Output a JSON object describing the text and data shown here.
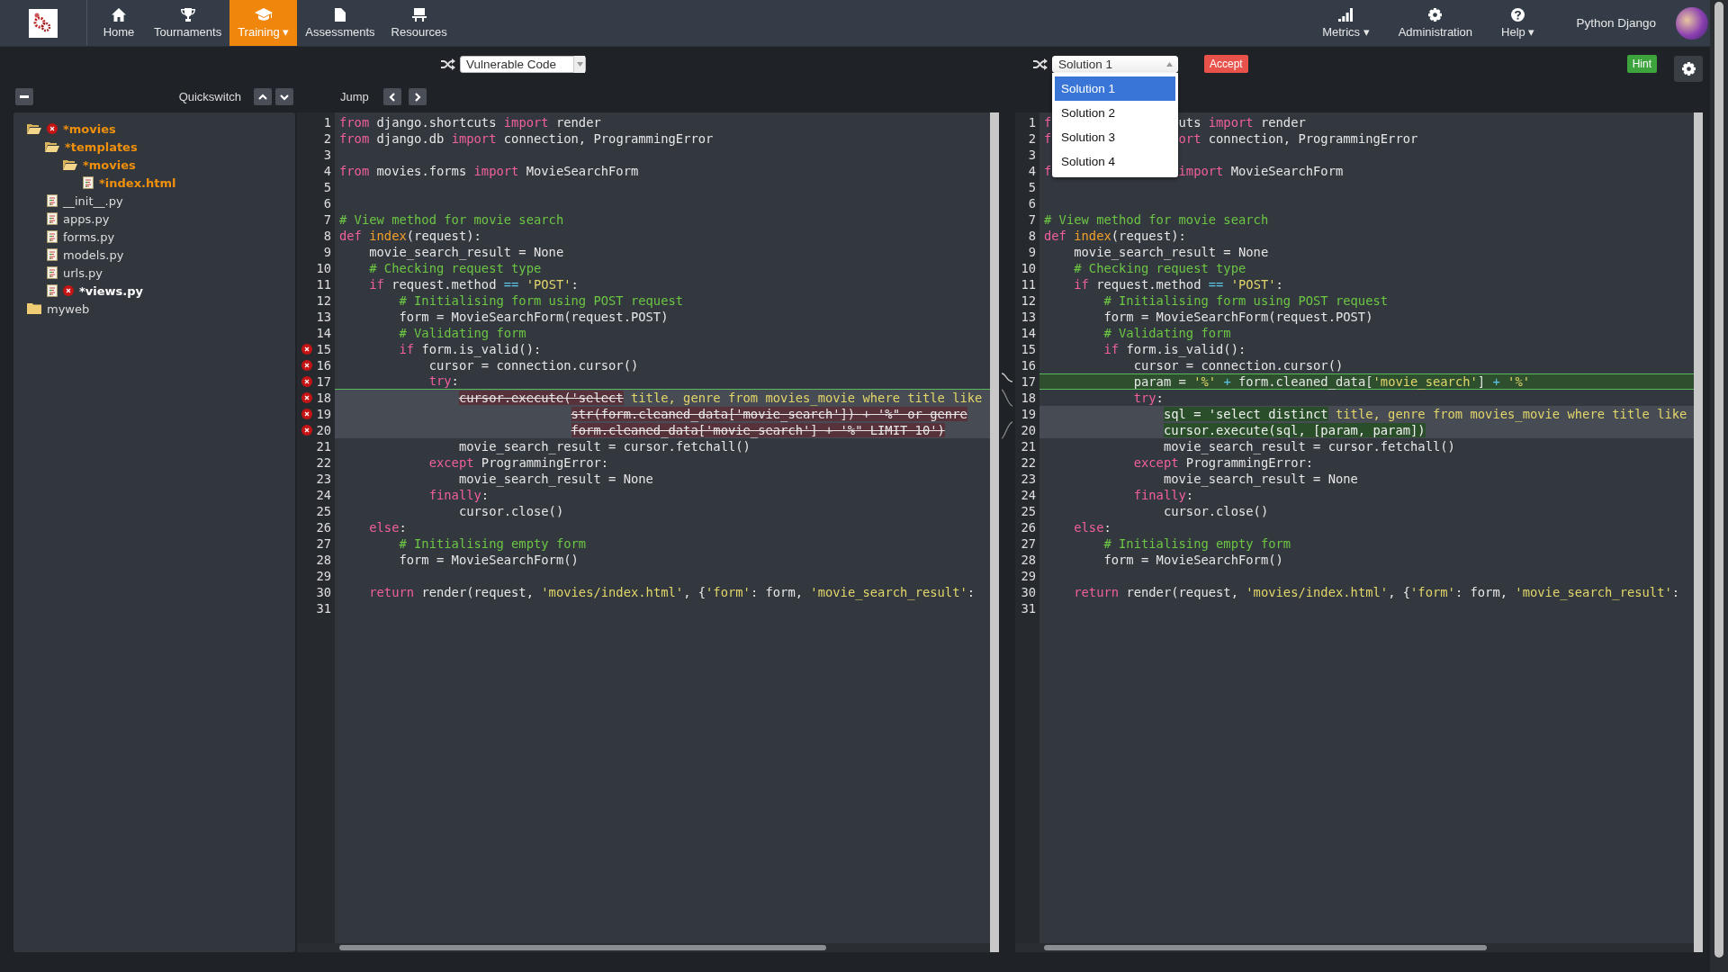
{
  "nav": {
    "items": [
      {
        "label": "Home",
        "selected": false
      },
      {
        "label": "Tournaments",
        "selected": false
      },
      {
        "label": "Training ▾",
        "selected": true
      },
      {
        "label": "Assessments",
        "selected": false
      },
      {
        "label": "Resources",
        "selected": false
      }
    ],
    "right_items": [
      {
        "label": "Metrics ▾"
      },
      {
        "label": "Administration"
      },
      {
        "label": "Help ▾"
      }
    ],
    "user": "Python Django"
  },
  "toolbar": {
    "quickswitch": "Quickswitch",
    "jump": "Jump",
    "left_select": "Vulnerable Code",
    "right_select": {
      "value": "Solution 1",
      "expanded": true,
      "options": [
        {
          "label": "Solution 1",
          "selected": true
        },
        {
          "label": "Solution 2",
          "selected": false
        },
        {
          "label": "Solution 3",
          "selected": false
        },
        {
          "label": "Solution 4",
          "selected": false
        }
      ]
    },
    "accept": "Accept",
    "hint": "Hint"
  },
  "tree": [
    {
      "label": "*movies",
      "kind": "folder",
      "expanded": true,
      "modified": true,
      "error": true,
      "selected": false,
      "children": [
        {
          "label": "*templates",
          "kind": "folder",
          "expanded": true,
          "modified": true,
          "error": false,
          "selected": false,
          "children": [
            {
              "label": "*movies",
              "kind": "folder",
              "expanded": true,
              "modified": true,
              "error": false,
              "selected": false,
              "children": [
                {
                  "label": "*index.html",
                  "kind": "file",
                  "modified": true,
                  "error": false,
                  "selected": false
                }
              ]
            }
          ]
        },
        {
          "label": "__init__.py",
          "kind": "file",
          "modified": false,
          "error": false,
          "selected": false
        },
        {
          "label": "apps.py",
          "kind": "file",
          "modified": false,
          "error": false,
          "selected": false
        },
        {
          "label": "forms.py",
          "kind": "file",
          "modified": false,
          "error": false,
          "selected": false
        },
        {
          "label": "models.py",
          "kind": "file",
          "modified": false,
          "error": false,
          "selected": false
        },
        {
          "label": "urls.py",
          "kind": "file",
          "modified": false,
          "error": false,
          "selected": false
        },
        {
          "label": "*views.py",
          "kind": "file",
          "modified": true,
          "error": true,
          "selected": true
        }
      ]
    },
    {
      "label": "myweb",
      "kind": "folder",
      "expanded": false,
      "modified": false,
      "error": false,
      "selected": false
    }
  ],
  "panes": [
    {
      "lines": [
        {
          "n": "1",
          "error": false,
          "kind": "plain",
          "segs": [
            {
              "text": "from",
              "kind": "keyword"
            },
            {
              "text": " django.shortcuts ",
              "kind": "plain"
            },
            {
              "text": "import",
              "kind": "keyword"
            },
            {
              "text": " render",
              "kind": "plain"
            }
          ]
        },
        {
          "n": "2",
          "error": false,
          "kind": "plain",
          "segs": [
            {
              "text": "from",
              "kind": "keyword"
            },
            {
              "text": " django.db ",
              "kind": "plain"
            },
            {
              "text": "import",
              "kind": "keyword"
            },
            {
              "text": " connection, ProgrammingError",
              "kind": "plain"
            }
          ]
        },
        {
          "n": "3",
          "error": false,
          "kind": "plain"
        },
        {
          "n": "4",
          "error": false,
          "kind": "plain",
          "segs": [
            {
              "text": "from",
              "kind": "keyword"
            },
            {
              "text": " movies.forms ",
              "kind": "plain"
            },
            {
              "text": "import",
              "kind": "keyword"
            },
            {
              "text": " MovieSearchForm",
              "kind": "plain"
            }
          ]
        },
        {
          "n": "5",
          "error": false,
          "kind": "plain"
        },
        {
          "n": "6",
          "error": false,
          "kind": "plain"
        },
        {
          "n": "7",
          "error": false,
          "kind": "plain",
          "segs": [
            {
              "text": "# View method for movie search",
              "kind": "comment"
            }
          ]
        },
        {
          "n": "8",
          "error": false,
          "kind": "plain",
          "segs": [
            {
              "text": "def",
              "kind": "keyword"
            },
            {
              "text": " index",
              "kind": "name"
            },
            {
              "text": "(request):",
              "kind": "plain"
            }
          ]
        },
        {
          "n": "9",
          "error": false,
          "kind": "plain",
          "segs": [
            {
              "text": "    movie_search_result = None",
              "kind": "plain"
            }
          ]
        },
        {
          "n": "10",
          "error": false,
          "kind": "plain",
          "segs": [
            {
              "text": "    # Checking request type",
              "kind": "comment"
            }
          ]
        },
        {
          "n": "11",
          "error": false,
          "kind": "plain",
          "segs": [
            {
              "text": "    if",
              "kind": "keyword"
            },
            {
              "text": " request.method ",
              "kind": "plain"
            },
            {
              "text": "==",
              "kind": "op"
            },
            {
              "text": " 'POST'",
              "kind": "string"
            },
            {
              "text": ":",
              "kind": "plain"
            }
          ]
        },
        {
          "n": "12",
          "error": false,
          "kind": "plain",
          "segs": [
            {
              "text": "        # Initialising form using POST request",
              "kind": "comment"
            }
          ]
        },
        {
          "n": "13",
          "error": false,
          "kind": "plain",
          "segs": [
            {
              "text": "        form = MovieSearchForm(request.POST)",
              "kind": "plain"
            }
          ]
        },
        {
          "n": "14",
          "error": false,
          "kind": "plain",
          "segs": [
            {
              "text": "        # Validating form",
              "kind": "comment"
            }
          ]
        },
        {
          "n": "15",
          "error": true,
          "kind": "plain",
          "segs": [
            {
              "text": "        if",
              "kind": "keyword"
            },
            {
              "text": " form.is_valid():",
              "kind": "plain"
            }
          ]
        },
        {
          "n": "16",
          "error": true,
          "kind": "plain",
          "segs": [
            {
              "text": "            cursor = connection.cursor()",
              "kind": "plain"
            }
          ]
        },
        {
          "n": "17",
          "error": true,
          "kind": "ruled",
          "segs": [
            {
              "text": "            try",
              "kind": "keyword"
            },
            {
              "text": ":",
              "kind": "plain"
            }
          ]
        },
        {
          "n": "18",
          "error": true,
          "kind": "changed",
          "segs": [
            {
              "text": "                cursor.execute('select",
              "kind": "removed"
            },
            {
              "text": " title, genre from movies_movie where title like",
              "kind": "string"
            }
          ]
        },
        {
          "n": "19",
          "error": true,
          "kind": "changed",
          "segs": [
            {
              "text": "                               str(form.cleaned_data['movie_search']) + '%\" or genre",
              "kind": "removed"
            }
          ]
        },
        {
          "n": "20",
          "error": true,
          "kind": "changed",
          "segs": [
            {
              "text": "                               form.cleaned_data['movie_search'] + '%\" LIMIT 10')",
              "kind": "removed"
            }
          ]
        },
        {
          "n": "21",
          "error": false,
          "kind": "plain",
          "segs": [
            {
              "text": "                movie_search_result = cursor.fetchall()",
              "kind": "plain"
            }
          ]
        },
        {
          "n": "22",
          "error": false,
          "kind": "plain",
          "segs": [
            {
              "text": "            except",
              "kind": "keyword"
            },
            {
              "text": " ProgrammingError:",
              "kind": "plain"
            }
          ]
        },
        {
          "n": "23",
          "error": false,
          "kind": "plain",
          "segs": [
            {
              "text": "                movie_search_result = None",
              "kind": "plain"
            }
          ]
        },
        {
          "n": "24",
          "error": false,
          "kind": "plain",
          "segs": [
            {
              "text": "            finally",
              "kind": "keyword"
            },
            {
              "text": ":",
              "kind": "plain"
            }
          ]
        },
        {
          "n": "25",
          "error": false,
          "kind": "plain",
          "segs": [
            {
              "text": "                cursor.close()",
              "kind": "plain"
            }
          ]
        },
        {
          "n": "26",
          "error": false,
          "kind": "plain",
          "segs": [
            {
              "text": "    else",
              "kind": "keyword"
            },
            {
              "text": ":",
              "kind": "plain"
            }
          ]
        },
        {
          "n": "27",
          "error": false,
          "kind": "plain",
          "segs": [
            {
              "text": "        # Initialising empty form",
              "kind": "comment"
            }
          ]
        },
        {
          "n": "28",
          "error": false,
          "kind": "plain",
          "segs": [
            {
              "text": "        form = MovieSearchForm()",
              "kind": "plain"
            }
          ]
        },
        {
          "n": "29",
          "error": false,
          "kind": "plain"
        },
        {
          "n": "30",
          "error": false,
          "kind": "plain",
          "segs": [
            {
              "text": "    return",
              "kind": "keyword"
            },
            {
              "text": " render(request, ",
              "kind": "plain"
            },
            {
              "text": "'movies/index.html'",
              "kind": "string"
            },
            {
              "text": ", {",
              "kind": "plain"
            },
            {
              "text": "'form'",
              "kind": "string"
            },
            {
              "text": ": form, ",
              "kind": "plain"
            },
            {
              "text": "'movie_search_result'",
              "kind": "string"
            },
            {
              "text": ":",
              "kind": "plain"
            }
          ]
        },
        {
          "n": "31",
          "error": false,
          "kind": "plain"
        }
      ]
    },
    {
      "lines": [
        {
          "n": "1",
          "error": false,
          "kind": "covered",
          "segs": [
            {
              "text": "f",
              "kind": "keyword"
            },
            {
              "text": "uts ",
              "kind": "plain"
            },
            {
              "text": "import",
              "kind": "keyword"
            },
            {
              "text": " render",
              "kind": "plain"
            }
          ]
        },
        {
          "n": "2",
          "error": false,
          "kind": "covered",
          "segs": [
            {
              "text": "f",
              "kind": "keyword"
            },
            {
              "text": "ort",
              "kind": "keyword"
            },
            {
              "text": " connection, ProgrammingError",
              "kind": "plain"
            }
          ]
        },
        {
          "n": "3",
          "error": false,
          "kind": "plain"
        },
        {
          "n": "4",
          "error": false,
          "kind": "covered",
          "segs": [
            {
              "text": "f",
              "kind": "keyword"
            },
            {
              "text": "import",
              "kind": "keyword"
            },
            {
              "text": " MovieSearchForm",
              "kind": "plain"
            }
          ]
        },
        {
          "n": "5",
          "error": false,
          "kind": "plain"
        },
        {
          "n": "6",
          "error": false,
          "kind": "plain"
        },
        {
          "n": "7",
          "error": false,
          "kind": "plain",
          "segs": [
            {
              "text": "# View method for movie search",
              "kind": "comment"
            }
          ]
        },
        {
          "n": "8",
          "error": false,
          "kind": "plain",
          "segs": [
            {
              "text": "def",
              "kind": "keyword"
            },
            {
              "text": " index",
              "kind": "name"
            },
            {
              "text": "(request):",
              "kind": "plain"
            }
          ]
        },
        {
          "n": "9",
          "error": false,
          "kind": "plain",
          "segs": [
            {
              "text": "    movie_search_result = None",
              "kind": "plain"
            }
          ]
        },
        {
          "n": "10",
          "error": false,
          "kind": "plain",
          "segs": [
            {
              "text": "    # Checking request type",
              "kind": "comment"
            }
          ]
        },
        {
          "n": "11",
          "error": false,
          "kind": "plain",
          "segs": [
            {
              "text": "    if",
              "kind": "keyword"
            },
            {
              "text": " request.method ",
              "kind": "plain"
            },
            {
              "text": "==",
              "kind": "op"
            },
            {
              "text": " 'POST'",
              "kind": "string"
            },
            {
              "text": ":",
              "kind": "plain"
            }
          ]
        },
        {
          "n": "12",
          "error": false,
          "kind": "plain",
          "segs": [
            {
              "text": "        # Initialising form using POST request",
              "kind": "comment"
            }
          ]
        },
        {
          "n": "13",
          "error": false,
          "kind": "plain",
          "segs": [
            {
              "text": "        form = MovieSearchForm(request.POST)",
              "kind": "plain"
            }
          ]
        },
        {
          "n": "14",
          "error": false,
          "kind": "plain",
          "segs": [
            {
              "text": "        # Validating form",
              "kind": "comment"
            }
          ]
        },
        {
          "n": "15",
          "error": false,
          "kind": "plain",
          "segs": [
            {
              "text": "        if",
              "kind": "keyword"
            },
            {
              "text": " form.is_valid():",
              "kind": "plain"
            }
          ]
        },
        {
          "n": "16",
          "error": false,
          "kind": "plain",
          "segs": [
            {
              "text": "            cursor = connection.cursor()",
              "kind": "plain"
            }
          ]
        },
        {
          "n": "17",
          "error": false,
          "kind": "added",
          "segs": [
            {
              "text": "            param = ",
              "kind": "plain"
            },
            {
              "text": "'%'",
              "kind": "string"
            },
            {
              "text": " +",
              "kind": "op"
            },
            {
              "text": " form.cleaned_data[",
              "kind": "plain"
            },
            {
              "text": "'movie_search'",
              "kind": "string"
            },
            {
              "text": "]",
              "kind": "plain"
            },
            {
              "text": " +",
              "kind": "op"
            },
            {
              "text": " '%'",
              "kind": "string"
            }
          ]
        },
        {
          "n": "18",
          "error": false,
          "kind": "plain",
          "segs": [
            {
              "text": "            try",
              "kind": "keyword"
            },
            {
              "text": ":",
              "kind": "plain"
            }
          ]
        },
        {
          "n": "19",
          "error": false,
          "kind": "changed",
          "segs": [
            {
              "text": "                sql = 'select distinct",
              "kind": "added"
            },
            {
              "text": " title, genre from movies_movie where title like",
              "kind": "string"
            }
          ]
        },
        {
          "n": "20",
          "error": false,
          "kind": "changed",
          "segs": [
            {
              "text": "                cursor.execute(sql, [param, param])",
              "kind": "added"
            }
          ]
        },
        {
          "n": "21",
          "error": false,
          "kind": "plain",
          "segs": [
            {
              "text": "                movie_search_result = cursor.fetchall()",
              "kind": "plain"
            }
          ]
        },
        {
          "n": "22",
          "error": false,
          "kind": "plain",
          "segs": [
            {
              "text": "            except",
              "kind": "keyword"
            },
            {
              "text": " ProgrammingError:",
              "kind": "plain"
            }
          ]
        },
        {
          "n": "23",
          "error": false,
          "kind": "plain",
          "segs": [
            {
              "text": "                movie_search_result = None",
              "kind": "plain"
            }
          ]
        },
        {
          "n": "24",
          "error": false,
          "kind": "plain",
          "segs": [
            {
              "text": "            finally",
              "kind": "keyword"
            },
            {
              "text": ":",
              "kind": "plain"
            }
          ]
        },
        {
          "n": "25",
          "error": false,
          "kind": "plain",
          "segs": [
            {
              "text": "                cursor.close()",
              "kind": "plain"
            }
          ]
        },
        {
          "n": "26",
          "error": false,
          "kind": "plain",
          "segs": [
            {
              "text": "    else",
              "kind": "keyword"
            },
            {
              "text": ":",
              "kind": "plain"
            }
          ]
        },
        {
          "n": "27",
          "error": false,
          "kind": "plain",
          "segs": [
            {
              "text": "        # Initialising empty form",
              "kind": "comment"
            }
          ]
        },
        {
          "n": "28",
          "error": false,
          "kind": "plain",
          "segs": [
            {
              "text": "        form = MovieSearchForm()",
              "kind": "plain"
            }
          ]
        },
        {
          "n": "29",
          "error": false,
          "kind": "plain"
        },
        {
          "n": "30",
          "error": false,
          "kind": "plain",
          "segs": [
            {
              "text": "    return",
              "kind": "keyword"
            },
            {
              "text": " render(request, ",
              "kind": "plain"
            },
            {
              "text": "'movies/index.html'",
              "kind": "string"
            },
            {
              "text": ", {",
              "kind": "plain"
            },
            {
              "text": "'form'",
              "kind": "string"
            },
            {
              "text": ": form, ",
              "kind": "plain"
            },
            {
              "text": "'movie_search_result'",
              "kind": "string"
            },
            {
              "text": ":",
              "kind": "plain"
            }
          ]
        },
        {
          "n": "31",
          "error": false,
          "kind": "plain"
        }
      ]
    }
  ]
}
